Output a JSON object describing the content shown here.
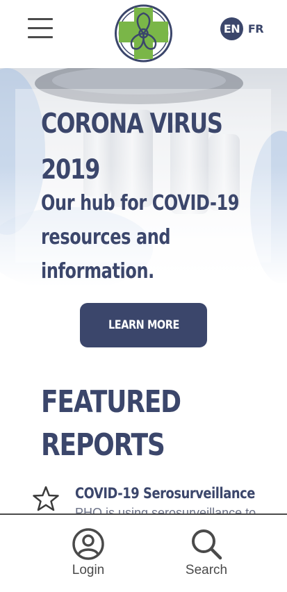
{
  "header": {
    "menu_icon": "hamburger-menu-icon",
    "logo_icon": "cross-emblem-logo",
    "languages": {
      "en": "EN",
      "fr": "FR",
      "active": "EN"
    }
  },
  "hero": {
    "title_line1": "CORONA VIRUS",
    "title_line2": "2019",
    "subtitle_line1": "Our hub for COVID-19",
    "subtitle_line2": "resources and",
    "subtitle_line3": "information.",
    "button_label": "LEARN MORE"
  },
  "featured": {
    "title_line1": "FEATURED",
    "title_line2": "REPORTS",
    "items": [
      {
        "icon": "star-icon",
        "title": "COVID-19 Serosurveillance",
        "description": "PHO is using serosurveillance to"
      }
    ]
  },
  "bottom_nav": {
    "items": [
      {
        "label": "Login",
        "icon": "user-icon"
      },
      {
        "label": "Search",
        "icon": "search-icon"
      }
    ]
  },
  "colors": {
    "primary": "#3b466b",
    "logo_green": "#7ab648",
    "logo_ring": "#3b466b"
  }
}
